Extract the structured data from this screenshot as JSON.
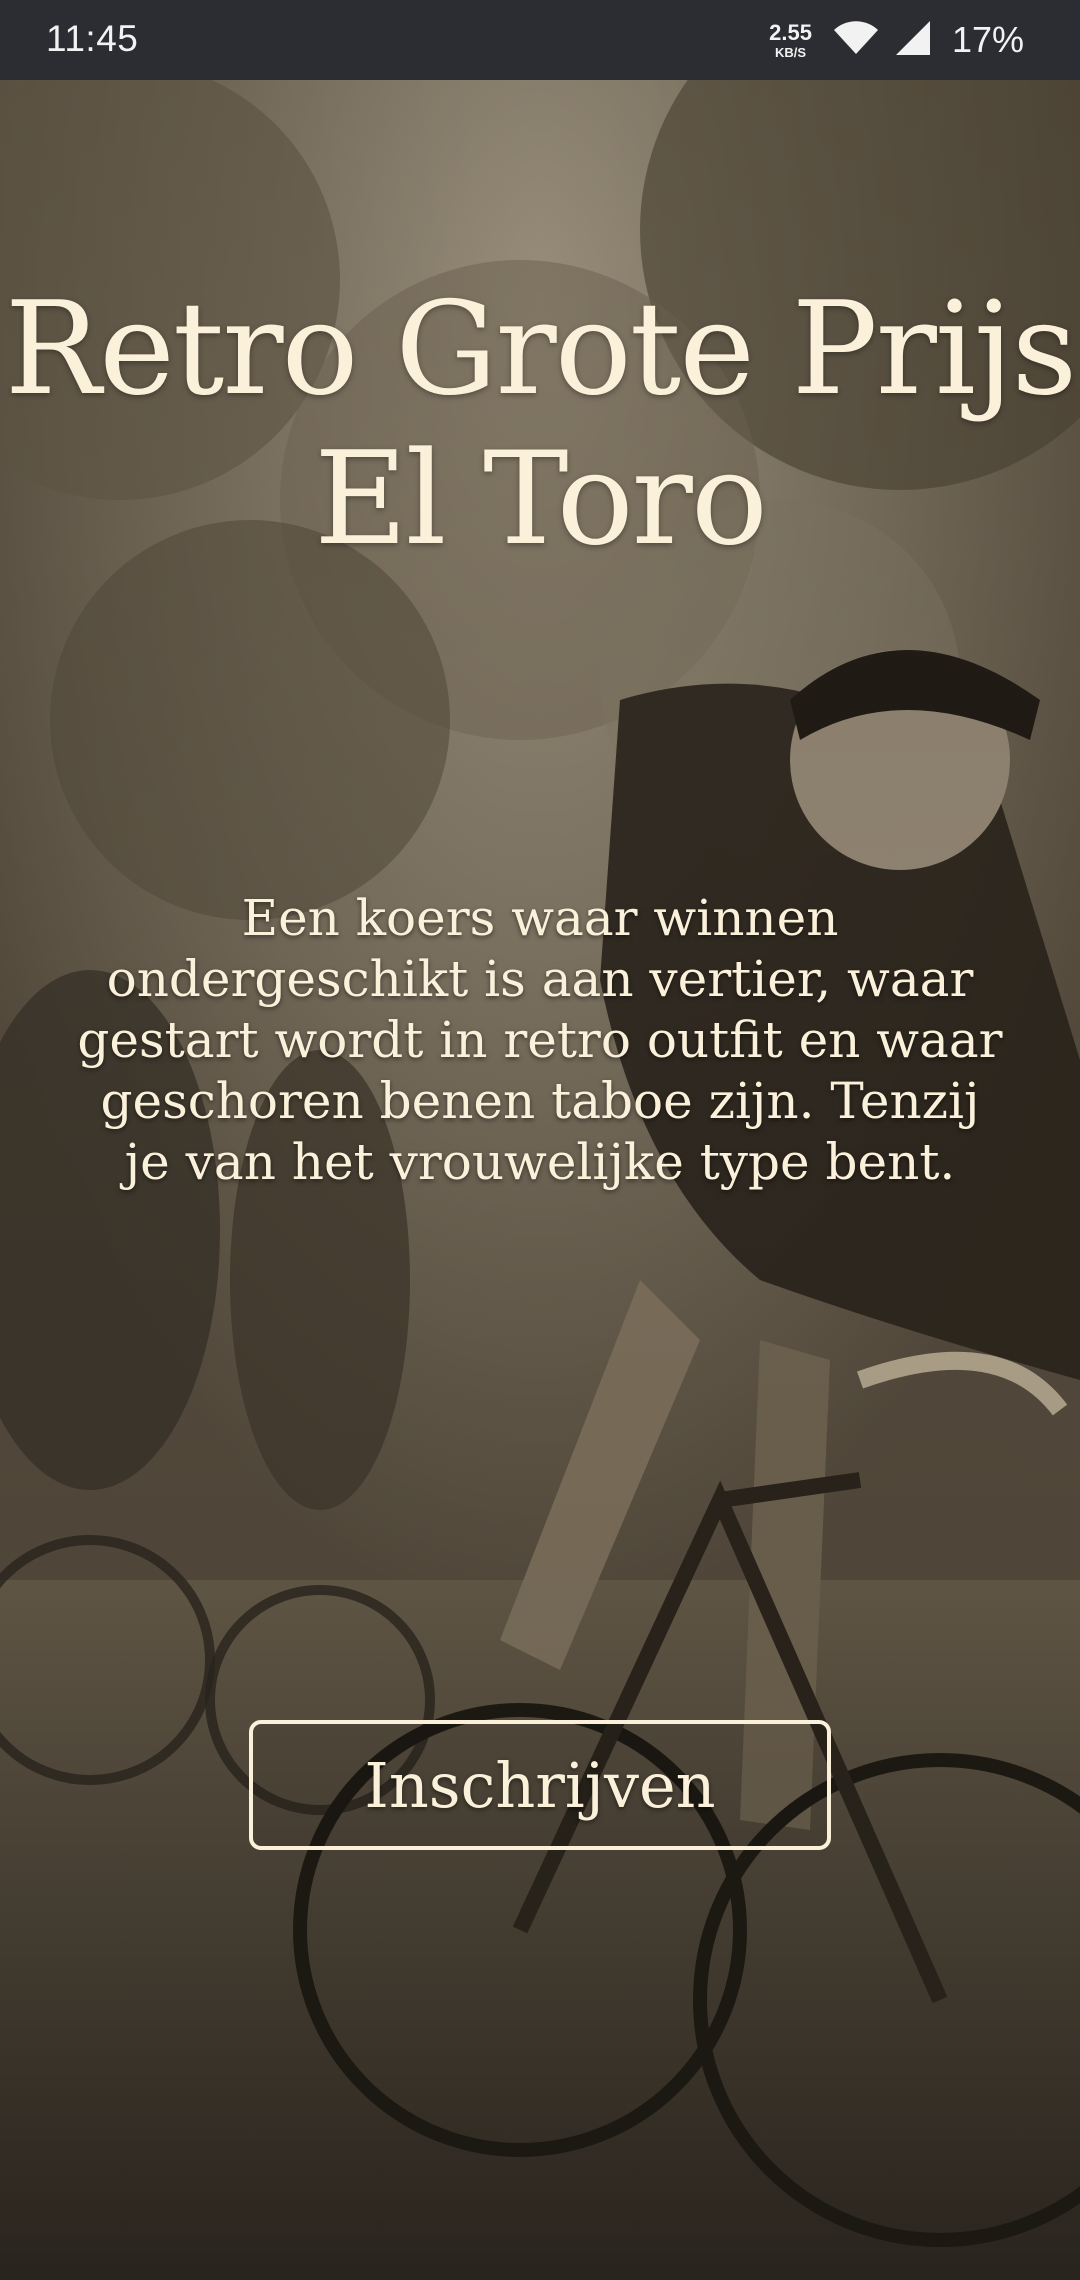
{
  "status_bar": {
    "time": "11:45",
    "net_speed_value": "2.55",
    "net_speed_unit": "KB/S",
    "battery": "17%",
    "icons": [
      "wifi-icon",
      "signal-icon"
    ]
  },
  "hero": {
    "background_image": "sepia vintage cycling race photo",
    "title_line1": "Retro Grote Prijs",
    "title_line2": "El Toro",
    "intro": "Een koers waar winnen ondergeschikt is aan vertier, waar gestart wordt in retro outfit en waar geschoren benen taboe zijn. Tenzij je van het vrouwelijke type bent.",
    "cta_label": "Inschrijven"
  },
  "colors": {
    "status_bar_bg": "#2c2c33",
    "text_cream": "#fbf0d9",
    "sepia_mid": "#8a7a62"
  }
}
